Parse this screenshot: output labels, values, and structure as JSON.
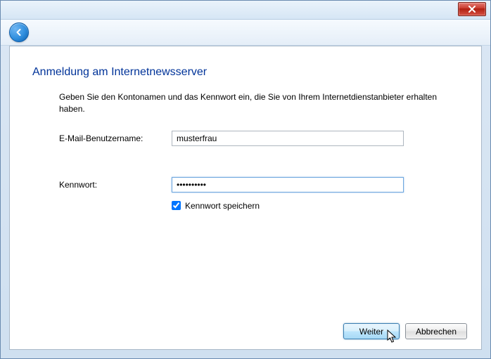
{
  "titlebar": {},
  "heading": "Anmeldung am Internetnewsserver",
  "instructions": "Geben Sie den Kontonamen und das Kennwort ein, die Sie von Ihrem Internetdienstanbieter erhalten haben.",
  "form": {
    "username_label": "E-Mail-Benutzername:",
    "username_value": "musterfrau",
    "password_label": "Kennwort:",
    "password_value": "••••••••••",
    "remember_label": "Kennwort speichern",
    "remember_checked": true
  },
  "buttons": {
    "next": "Weiter",
    "cancel": "Abbrechen"
  }
}
